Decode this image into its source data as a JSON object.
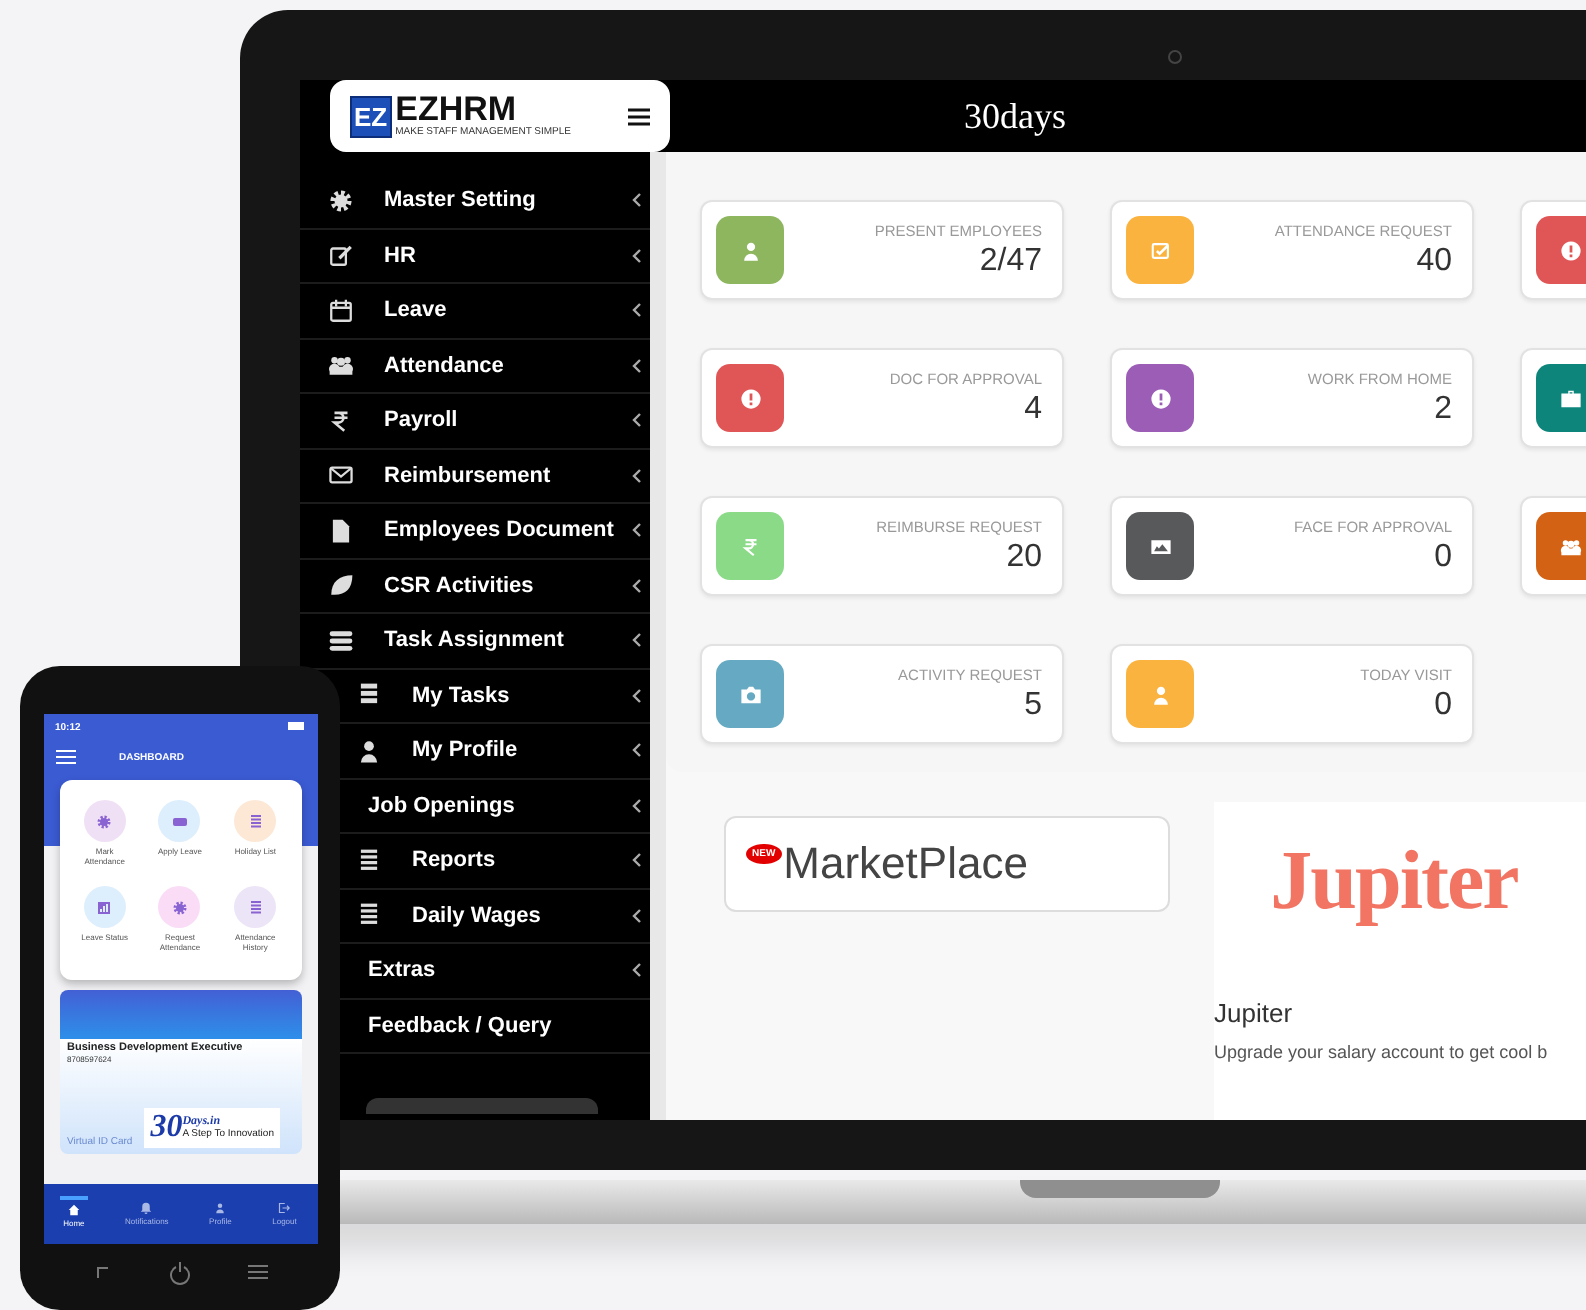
{
  "header": {
    "logo_mark": "EZ",
    "logo_text": "EZHRM",
    "logo_tagline": "MAKE STAFF MANAGEMENT SIMPLE",
    "title": "30days"
  },
  "sidebar": {
    "items": [
      {
        "label": "Master Setting",
        "kind": "gear",
        "expandable": true
      },
      {
        "label": "HR",
        "kind": "edit",
        "expandable": true
      },
      {
        "label": "Leave",
        "kind": "calendar",
        "expandable": true
      },
      {
        "label": "Attendance",
        "kind": "users",
        "expandable": true
      },
      {
        "label": "Payroll",
        "kind": "rupee",
        "expandable": true
      },
      {
        "label": "Reimbursement",
        "kind": "envelope",
        "expandable": true
      },
      {
        "label": "Employees Document",
        "kind": "file",
        "expandable": true
      },
      {
        "label": "CSR Activities",
        "kind": "leaf",
        "expandable": true
      },
      {
        "label": "Task Assignment",
        "kind": "stack",
        "expandable": true
      },
      {
        "label": "My Tasks",
        "kind": "tasks",
        "expandable": true
      },
      {
        "label": "My Profile",
        "kind": "user",
        "expandable": true
      },
      {
        "label": "Job Openings",
        "expandable": true
      },
      {
        "label": "Reports",
        "kind": "list",
        "expandable": true
      },
      {
        "label": "Daily Wages",
        "kind": "list",
        "expandable": true
      },
      {
        "label": "Extras",
        "expandable": true
      },
      {
        "label": "Feedback / Query",
        "expandable": false
      }
    ]
  },
  "stats": [
    {
      "label": "PRESENT EMPLOYEES",
      "value": "2/47",
      "kind": "user",
      "color": "#8db65f"
    },
    {
      "label": "ATTENDANCE REQUEST",
      "value": "40",
      "kind": "check",
      "color": "#fbb33f"
    },
    {
      "kind": "alert",
      "color": "#e05555"
    },
    {
      "label": "DOC FOR APPROVAL",
      "value": "4",
      "kind": "alert",
      "color": "#e05555"
    },
    {
      "label": "WORK FROM HOME",
      "value": "2",
      "kind": "alert",
      "color": "#9b5db5"
    },
    {
      "kind": "briefcase",
      "color": "#0e857b"
    },
    {
      "label": "REIMBURSE REQUEST",
      "value": "20",
      "kind": "rupee",
      "color": "#8bda88"
    },
    {
      "label": "FACE FOR APPROVAL",
      "value": "0",
      "kind": "image",
      "color": "#58595b"
    },
    {
      "kind": "users",
      "color": "#d46214"
    },
    {
      "label": "ACTIVITY REQUEST",
      "value": "5",
      "kind": "camera",
      "color": "#65aac2"
    },
    {
      "label": "TODAY VISIT",
      "value": "0",
      "kind": "user",
      "color": "#fbb33f"
    }
  ],
  "marketplace": {
    "badge": "NEW",
    "label": "MarketPlace"
  },
  "offer": {
    "logo": "Jupiter",
    "title": "Jupiter",
    "description": "Upgrade your salary account to get cool b"
  },
  "phone": {
    "time": "10:12",
    "title": "DASHBOARD",
    "shortcuts": [
      {
        "label": "Mark Attendance",
        "kind": "gear",
        "color": "#f0e0f5"
      },
      {
        "label": "Apply Leave",
        "kind": "card",
        "color": "#ddeefc"
      },
      {
        "label": "Holiday List",
        "kind": "list",
        "color": "#fde8d6"
      },
      {
        "label": "Leave Status",
        "kind": "chart",
        "color": "#ddeefc"
      },
      {
        "label": "Request Attendance",
        "kind": "gear",
        "color": "#fadcf7"
      },
      {
        "label": "Attendance History",
        "kind": "list",
        "color": "#ece4f7"
      }
    ],
    "id_card": {
      "role": "Business Development Executive",
      "number": "8708597624",
      "caption": "Virtual ID Card",
      "brand": "30",
      "brand_name": "Days.in",
      "brand_tagline": "A Step To Innovation"
    },
    "nav": [
      {
        "label": "Home",
        "kind": "home",
        "selected": true
      },
      {
        "label": "Notifications",
        "kind": "bell",
        "selected": false
      },
      {
        "label": "Profile",
        "kind": "user",
        "selected": false
      },
      {
        "label": "Logout",
        "kind": "logout",
        "selected": false
      }
    ]
  }
}
